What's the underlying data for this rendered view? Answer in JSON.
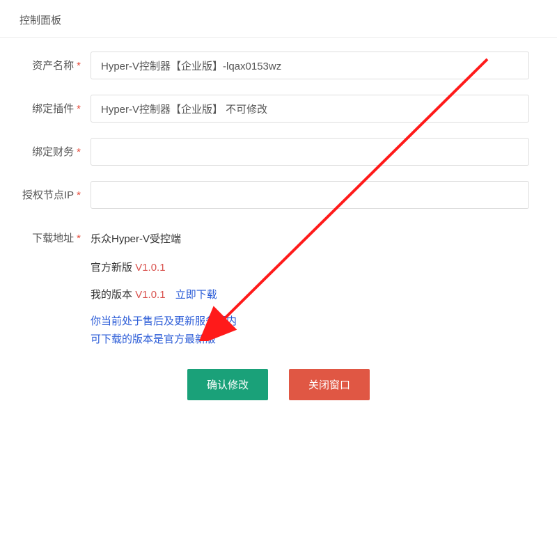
{
  "panel": {
    "title": "控制面板"
  },
  "form": {
    "asset_name": {
      "label": "资产名称",
      "value": "Hyper-V控制器【企业版】-lqax0153wz"
    },
    "bind_plugin": {
      "label": "绑定插件",
      "value": "Hyper-V控制器【企业版】 不可修改"
    },
    "bind_finance": {
      "label": "绑定财务",
      "value": ""
    },
    "auth_node_ip": {
      "label": "授权节点IP",
      "value": ""
    },
    "download": {
      "label": "下载地址",
      "title": "乐众Hyper-V受控端",
      "official_prefix": "官方新版",
      "official_version": "V1.0.1",
      "my_prefix": "我的版本",
      "my_version": "V1.0.1",
      "download_link": "立即下载",
      "service_note_line1": "你当前处于售后及更新服务期内",
      "service_note_line2": "可下载的版本是官方最新版"
    }
  },
  "buttons": {
    "confirm": "确认修改",
    "cancel": "关闭窗口"
  }
}
